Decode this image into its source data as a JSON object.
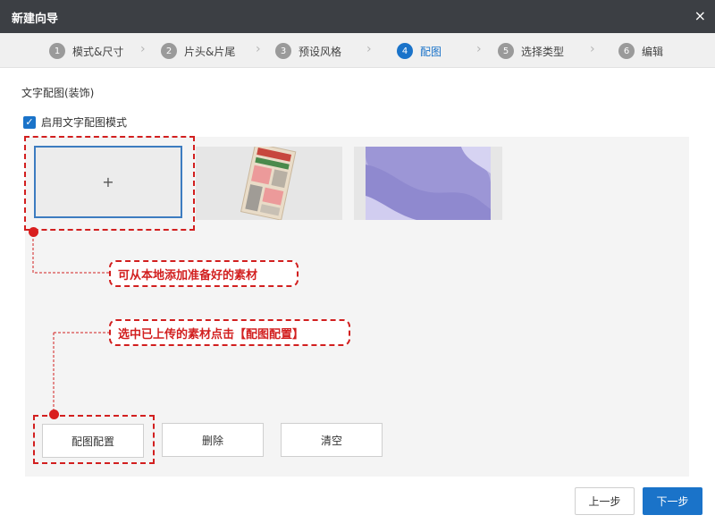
{
  "window": {
    "title": "新建向导",
    "close_icon": "×"
  },
  "steps": [
    {
      "num": "1",
      "label": "模式&尺寸"
    },
    {
      "num": "2",
      "label": "片头&片尾"
    },
    {
      "num": "3",
      "label": "预设风格"
    },
    {
      "num": "4",
      "label": "配图"
    },
    {
      "num": "5",
      "label": "选择类型"
    },
    {
      "num": "6",
      "label": "编辑"
    }
  ],
  "active_step": 4,
  "section": {
    "title": "文字配图(装饰)"
  },
  "enable": {
    "checked": true,
    "label": "启用文字配图模式"
  },
  "add_tile": {
    "symbol": "+"
  },
  "callouts": {
    "add_local": "可从本地添加准备好的素材",
    "select_config": "选中已上传的素材点击【配图配置】"
  },
  "buttons": {
    "config": "配图配置",
    "delete": "删除",
    "clear": "清空"
  },
  "footer": {
    "prev": "上一步",
    "next": "下一步"
  },
  "colors": {
    "accent": "#1a73c9",
    "annotation": "#d21f1f",
    "titlebar": "#3c3f44"
  }
}
